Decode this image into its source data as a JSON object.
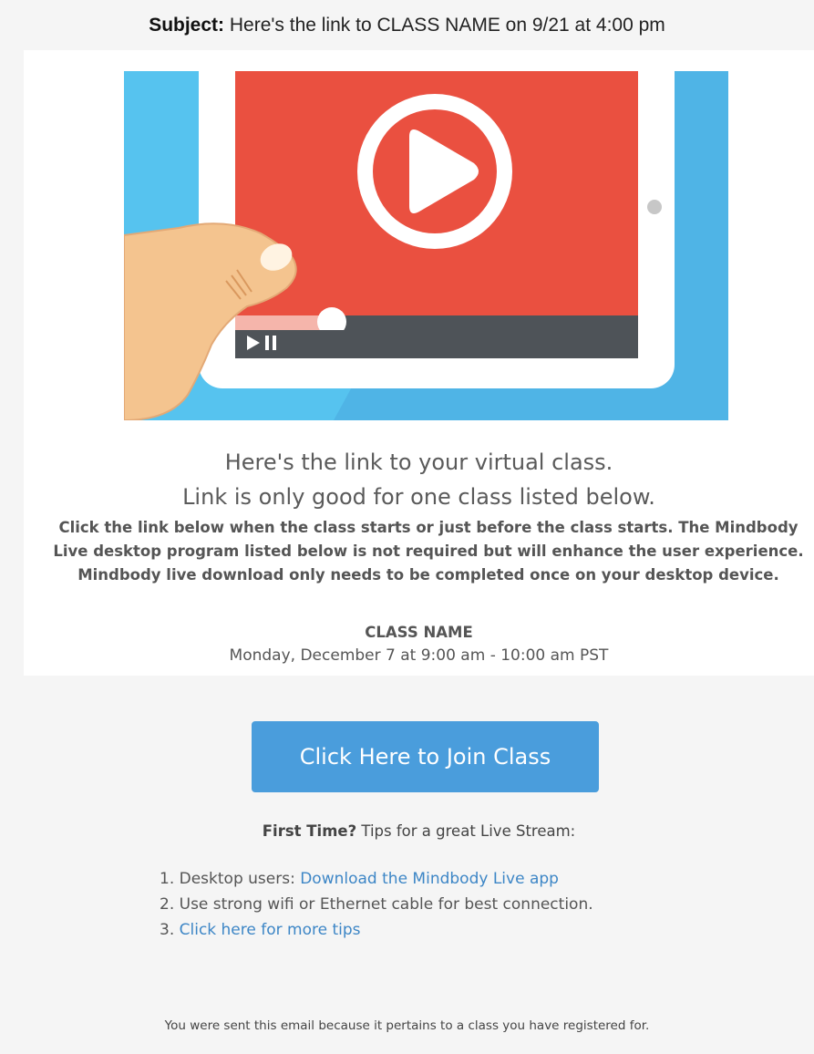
{
  "email": {
    "subject_label": "Subject:",
    "subject_text": "Here's the link to CLASS NAME on 9/21 at 4:00 pm"
  },
  "hero": {
    "colors": {
      "background": "#56c3ef",
      "tablet": "#ffffff",
      "screen": "#ea5040",
      "progress_played": "#f5b5ab",
      "control_bar": "#4e5358",
      "hand": "#f4c48f"
    }
  },
  "content": {
    "headline_1": "Here's the link to your virtual class.",
    "headline_2": "Link is only good for one class listed below.",
    "intro": "Click the link below when the class starts or just before the class starts. The Mindbody Live desktop program listed below is not required but will enhance the user experience. Mindbody live download only needs to be completed once on your desktop device.",
    "class_name": "CLASS NAME",
    "class_time": "Monday, December 7 at 9:00 am - 10:00 am PST",
    "join_button": "Click Here to Join Class",
    "first_time_bold": "First Time?",
    "first_time_rest": " Tips for a great Live Stream:",
    "tips": [
      {
        "prefix": "1. Desktop users: ",
        "link": "Download the Mindbody Live app",
        "text": ""
      },
      {
        "prefix": "2. Use strong wifi or Ethernet cable for best connection.",
        "link": "",
        "text": ""
      },
      {
        "prefix": "3. ",
        "link": "Click here for more tips",
        "text": ""
      }
    ],
    "accent_color": "#4a9ddc",
    "link_color": "#3d86c6"
  },
  "footer": {
    "text": "You were sent this email because it pertains to a class you have registered for."
  }
}
